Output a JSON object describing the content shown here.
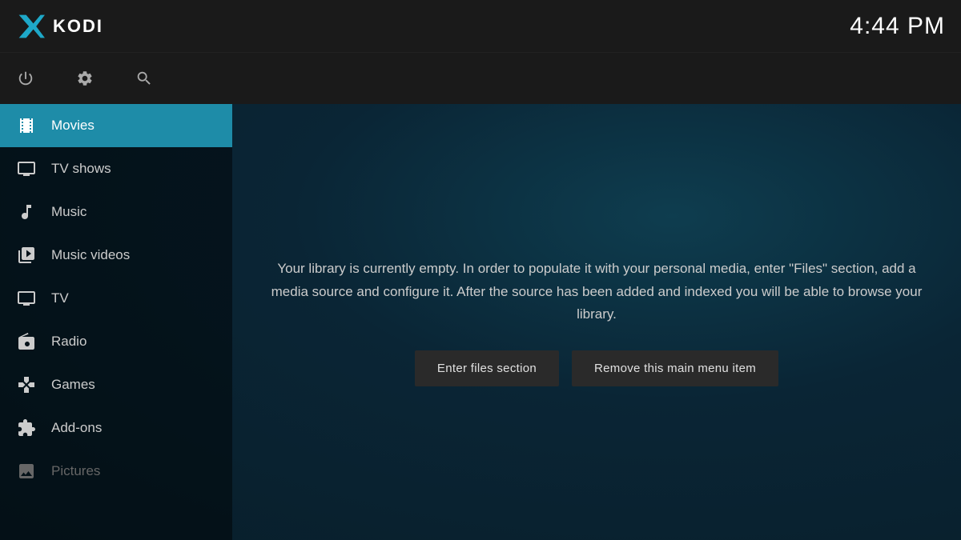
{
  "header": {
    "app_name": "KODI",
    "clock": "4:44 PM"
  },
  "controls": [
    {
      "name": "power-icon",
      "symbol": "⏻",
      "label": "Power"
    },
    {
      "name": "settings-icon",
      "symbol": "⚙",
      "label": "Settings"
    },
    {
      "name": "search-icon",
      "symbol": "⌕",
      "label": "Search"
    }
  ],
  "sidebar": {
    "items": [
      {
        "name": "movies",
        "label": "Movies",
        "icon": "movies-icon",
        "active": true,
        "dimmed": false
      },
      {
        "name": "tv-shows",
        "label": "TV shows",
        "icon": "tv-shows-icon",
        "active": false,
        "dimmed": false
      },
      {
        "name": "music",
        "label": "Music",
        "icon": "music-icon",
        "active": false,
        "dimmed": false
      },
      {
        "name": "music-videos",
        "label": "Music videos",
        "icon": "music-videos-icon",
        "active": false,
        "dimmed": false
      },
      {
        "name": "tv",
        "label": "TV",
        "icon": "tv-icon",
        "active": false,
        "dimmed": false
      },
      {
        "name": "radio",
        "label": "Radio",
        "icon": "radio-icon",
        "active": false,
        "dimmed": false
      },
      {
        "name": "games",
        "label": "Games",
        "icon": "games-icon",
        "active": false,
        "dimmed": false
      },
      {
        "name": "add-ons",
        "label": "Add-ons",
        "icon": "addons-icon",
        "active": false,
        "dimmed": false
      },
      {
        "name": "pictures",
        "label": "Pictures",
        "icon": "pictures-icon",
        "active": false,
        "dimmed": true
      }
    ]
  },
  "main": {
    "empty_library_message": "Your library is currently empty. In order to populate it with your personal media, enter \"Files\" section, add a media source and configure it. After the source has been added and indexed you will be able to browse your library.",
    "button_enter_files": "Enter files section",
    "button_remove_item": "Remove this main menu item"
  }
}
